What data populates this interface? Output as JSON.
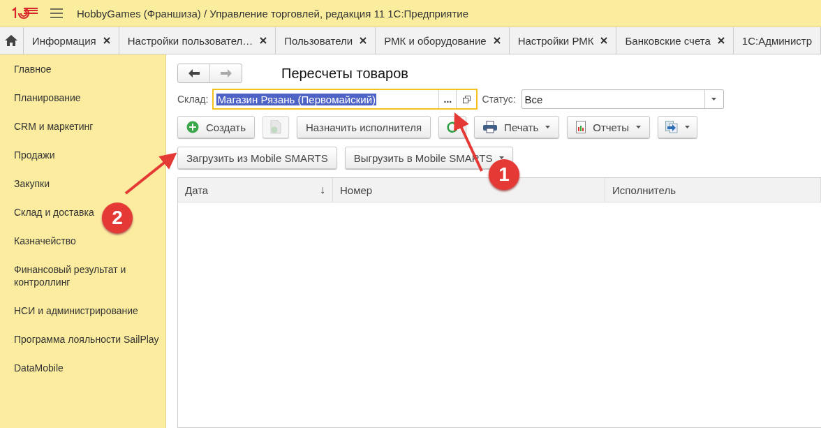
{
  "header": {
    "title": "HobbyGames (Франшиза) / Управление торговлей, редакция 11 1С:Предприятие"
  },
  "tabs": [
    {
      "label": "Информация",
      "selected": false,
      "closable": true
    },
    {
      "label": "Настройки пользовател…",
      "selected": false,
      "closable": true
    },
    {
      "label": "Пользователи",
      "selected": false,
      "closable": true
    },
    {
      "label": "РМК и оборудование",
      "selected": false,
      "closable": true
    },
    {
      "label": "Настройки РМК",
      "selected": false,
      "closable": true
    },
    {
      "label": "Банковские счета",
      "selected": false,
      "closable": true
    },
    {
      "label": "1С:Администр",
      "selected": false,
      "closable": false
    }
  ],
  "sidebar": {
    "items": [
      {
        "label": "Главное",
        "selected": false
      },
      {
        "label": "Планирование",
        "selected": false
      },
      {
        "label": "CRM и маркетинг",
        "selected": false
      },
      {
        "label": "Продажи",
        "selected": false
      },
      {
        "label": "Закупки",
        "selected": false
      },
      {
        "label": "Склад и доставка",
        "selected": false
      },
      {
        "label": "Казначейство",
        "selected": false
      },
      {
        "label": "Финансовый результат и контроллинг",
        "selected": false
      },
      {
        "label": "НСИ и администрирование",
        "selected": false
      },
      {
        "label": "Программа лояльности SailPlay",
        "selected": false
      },
      {
        "label": "DataMobile",
        "selected": false
      }
    ]
  },
  "form": {
    "title": "Пересчеты товаров",
    "warehouse": {
      "label": "Склад:",
      "value": "Магазин Рязань (Первомайский)",
      "value_selected": true,
      "focused": true,
      "choose_button": "..."
    },
    "status": {
      "label": "Статус:",
      "value": "Все"
    },
    "toolbar": [
      {
        "kind": "create",
        "label": "Создать",
        "disabled": false,
        "dropdown": false
      },
      {
        "kind": "copy",
        "disabled": true,
        "dropdown": false
      },
      {
        "kind": "text",
        "label": "Назначить исполнителя",
        "disabled": false,
        "dropdown": false
      },
      {
        "kind": "refresh",
        "disabled": false,
        "dropdown": false
      },
      {
        "kind": "print",
        "label": "Печать",
        "disabled": false,
        "dropdown": true
      },
      {
        "kind": "reports",
        "label": "Отчеты",
        "disabled": false,
        "dropdown": true
      },
      {
        "kind": "export",
        "disabled": false,
        "dropdown": true
      }
    ],
    "toolbar2": [
      {
        "label": "Загрузить из Mobile SMARTS",
        "dropdown": false
      },
      {
        "label": "Выгрузить в Mobile SMARTS",
        "dropdown": true
      }
    ],
    "table": {
      "columns": [
        {
          "label": "Дата",
          "sort": "↓"
        },
        {
          "label": "Номер"
        },
        {
          "label": "Исполнитель"
        }
      ]
    }
  },
  "annotations": [
    {
      "number": "1"
    },
    {
      "number": "2"
    }
  ]
}
